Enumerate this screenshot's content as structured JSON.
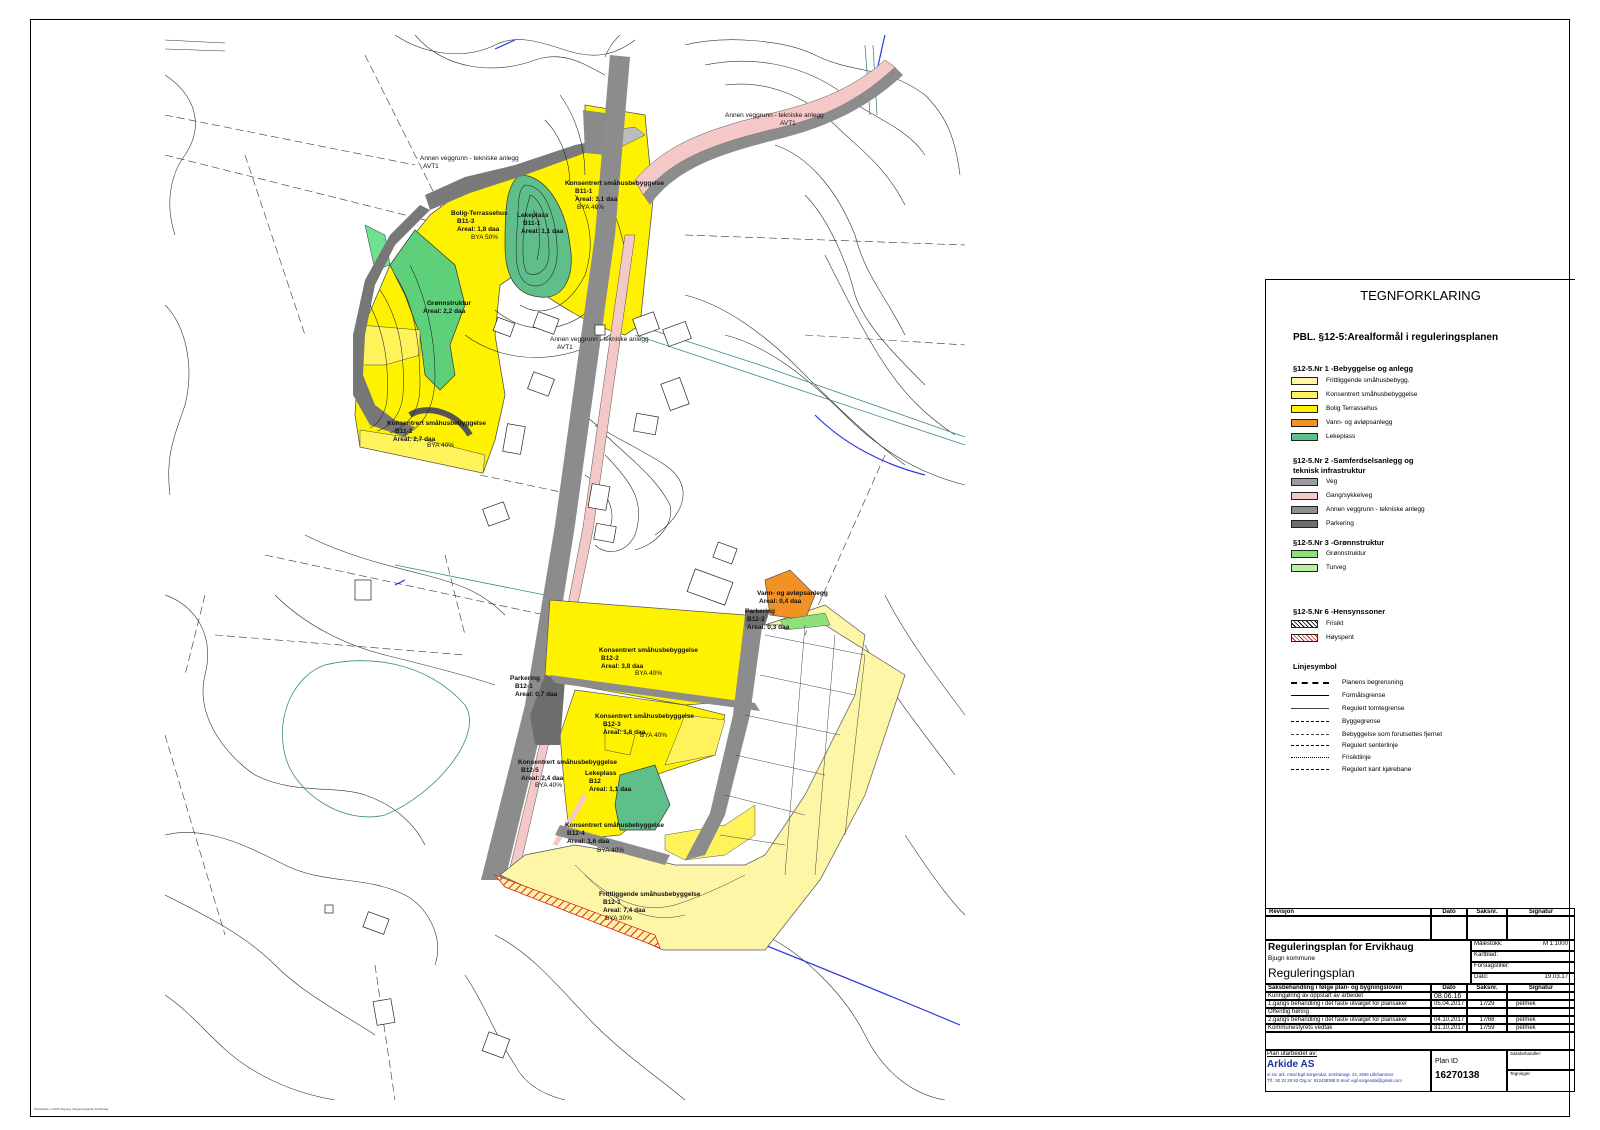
{
  "map": {
    "labels": [
      {
        "text": "Annen veggrunn - tekniske anlegg",
        "bold": false
      },
      {
        "text": "AVT1",
        "bold": false
      },
      {
        "text": "Annen veggrunn - tekniske anlegg",
        "bold": false
      },
      {
        "text": "AVT1",
        "bold": false
      },
      {
        "text": "Bolig-Terrassehus",
        "bold": true
      },
      {
        "text": "B11-3",
        "bold": true
      },
      {
        "text": "Areal: 1,8 daa",
        "bold": true
      },
      {
        "text": "BYA 50%",
        "bold": false
      },
      {
        "text": "Lekeplass",
        "bold": true
      },
      {
        "text": "B11-1",
        "bold": true
      },
      {
        "text": "Areal: 1,1 daa",
        "bold": true
      },
      {
        "text": "Konsentrert småhusbebyggelse",
        "bold": true
      },
      {
        "text": "B11-1",
        "bold": true
      },
      {
        "text": "Areal: 3,1 daa",
        "bold": true
      },
      {
        "text": "BYA 40%",
        "bold": false
      },
      {
        "text": "Grønnstruktur",
        "bold": true
      },
      {
        "text": "Areal: 2,2 daa",
        "bold": true
      },
      {
        "text": "Annen veggrunn - tekniske anlegg",
        "bold": false
      },
      {
        "text": "AVT1",
        "bold": false
      },
      {
        "text": "Konsentrert småhusbebyggelse",
        "bold": true
      },
      {
        "text": "B11-2",
        "bold": true
      },
      {
        "text": "Areal: 2,7 daa",
        "bold": true
      },
      {
        "text": "BYA 40%",
        "bold": false
      },
      {
        "text": "Vann- og avløpsanlegg",
        "bold": true
      },
      {
        "text": "Areal: 0,4 daa",
        "bold": true
      },
      {
        "text": "Parkering",
        "bold": true
      },
      {
        "text": "B12-2",
        "bold": true
      },
      {
        "text": "Areal: 0,3 daa",
        "bold": true
      },
      {
        "text": "Konsentrert småhusbebyggelse",
        "bold": true
      },
      {
        "text": "B12-2",
        "bold": true
      },
      {
        "text": "Areal: 3,8 daa",
        "bold": true
      },
      {
        "text": "BYA 40%",
        "bold": false
      },
      {
        "text": "Parkering",
        "bold": true
      },
      {
        "text": "B12-1",
        "bold": true
      },
      {
        "text": "Areal: 0,7 daa",
        "bold": true
      },
      {
        "text": "Konsentrert småhusbebyggelse",
        "bold": true
      },
      {
        "text": "B12-3",
        "bold": true
      },
      {
        "text": "Areal: 1,6 daa",
        "bold": true
      },
      {
        "text": "BYA 40%",
        "bold": false
      },
      {
        "text": "Konsentrert småhusbebyggelse",
        "bold": true
      },
      {
        "text": "B12-5",
        "bold": true
      },
      {
        "text": "Areal: 2,4 daa",
        "bold": true
      },
      {
        "text": "BYA 40%",
        "bold": false
      },
      {
        "text": "Lekeplass",
        "bold": true
      },
      {
        "text": "B12",
        "bold": true
      },
      {
        "text": "Areal: 1,1 daa",
        "bold": true
      },
      {
        "text": "Konsentrert småhusbebyggelse",
        "bold": true
      },
      {
        "text": "B12-4",
        "bold": true
      },
      {
        "text": "Areal: 1,6 daa",
        "bold": true
      },
      {
        "text": "BYA 40%",
        "bold": false
      },
      {
        "text": "Frittliggende småhusbebyggelse",
        "bold": true
      },
      {
        "text": "B12-1",
        "bold": true
      },
      {
        "text": "Areal: 7,4 daa",
        "bold": true
      },
      {
        "text": "BYA 30%",
        "bold": false
      }
    ]
  },
  "credit": "Plotteskala: 1:1000  Tegning: Reguleringsplan Ervikhaug",
  "legend": {
    "title": "TEGNFORKLARING",
    "subtitle": "PBL. §12-5:Arealformål i reguleringsplanen",
    "groups": [
      {
        "title": "§12-5.Nr 1 -Bebyggelse og anlegg",
        "items": [
          {
            "label": "Frittliggende småhusbebygg.",
            "color": "#fdf6a6"
          },
          {
            "label": "Konsentrert småhusbebyggelse",
            "color": "#fff35c"
          },
          {
            "label": "Bolig Terrassehus",
            "color": "#fff200"
          },
          {
            "label": "Vann- og avløpsanlegg",
            "color": "#f39224"
          },
          {
            "label": "Lekeplass",
            "color": "#5fbf8a"
          }
        ]
      },
      {
        "title": "§12-5.Nr 2 -Samferdselsanlegg og",
        "title2": "teknisk infrastruktur",
        "items": [
          {
            "label": "Veg",
            "color": "#9b9b9b"
          },
          {
            "label": "Gang/sykkelveg",
            "color": "#f5c8c8"
          },
          {
            "label": "Annen veggrunn - tekniske anlegg",
            "color": "#8f8f8f"
          },
          {
            "label": "Parkering",
            "color": "#6e6e6e"
          }
        ]
      },
      {
        "title": "§12-5.Nr 3 -Grønnstruktur",
        "items": [
          {
            "label": "Grønnstruktur",
            "color": "#8ee07a"
          },
          {
            "label": "Turveg",
            "color": "#b7f0a0"
          }
        ]
      },
      {
        "title": "§12-5.Nr 6 -Hensynssoner",
        "items": [
          {
            "label": "Frisikt",
            "color": "hatch-black"
          },
          {
            "label": "Høyspent",
            "color": "hatch-red"
          }
        ]
      }
    ],
    "lines_title": "Linjesymbol",
    "lines": [
      {
        "label": "Planens begrensning",
        "style": "dash-dot-thick"
      },
      {
        "label": "Formålsgrense",
        "style": "solid"
      },
      {
        "label": "Regulert tomtegrense",
        "style": "solid-thin"
      },
      {
        "label": "Byggegrense",
        "style": "dashed"
      },
      {
        "label": "Bebyggelse som forutsettes fjernet",
        "style": "dashed-fine"
      },
      {
        "label": "Regulert senterlinje",
        "style": "dash-dot"
      },
      {
        "label": "Frisiktlinje",
        "style": "dotted"
      },
      {
        "label": "Regulert kant kjørebane",
        "style": "dash-dot-long"
      }
    ]
  },
  "titleblock": {
    "rev_headers": [
      "Revisjon",
      "Dato",
      "Saksnr.",
      "Signatur"
    ],
    "plan_name": "Reguleringsplan for Ervikhaug",
    "municipality": "Bjugn kommune",
    "plan_type": "Reguleringsplan",
    "scale_label": "Målestokk:",
    "scale_value": "M 1:1000",
    "kartblad_label": "Kartblad:",
    "forslag_label": "Forslagstiller:",
    "dato_label": "Dato:",
    "dato_value": "19.03.17",
    "case_headers": [
      "Saksbehandling i følge plan- og bygningsloven",
      "Dato",
      "Saksnr.",
      "Signatur"
    ],
    "case_rows": [
      [
        "Kunngjøring av oppstart av arbeidet",
        "08.06.16",
        "",
        ""
      ],
      [
        "1.gangs behandling i det faste utvalget for plansaker",
        "05.04.2017",
        "17/29",
        "petmek"
      ],
      [
        "Offentlig høring",
        "",
        "",
        ""
      ],
      [
        "2.gangs behandling i det faste utvalget for plansaker",
        "04.10.2017",
        "17/68",
        "petmek"
      ],
      [
        "Kommunestyrets vedtak",
        "31.10.2017",
        "17/59",
        "petmek"
      ]
    ],
    "prepared_by": "Plan utarbeidet av:",
    "firm": "Arkide AS",
    "firm_line1": "v/ siv. ark. mnal Egil Sorgendal, Jernbanegt. 24, 2609 Lillehammer",
    "firm_line2": "Tlf.: 92 22 28 93 Org.nr: 912438368 E-mail: egil.sorgendal@gmail.com",
    "plan_id_label": "Plan ID",
    "plan_id": "16270138",
    "saksbehandler_label": "Saksbehandler:",
    "tegninger_label": "Tegninger:"
  }
}
